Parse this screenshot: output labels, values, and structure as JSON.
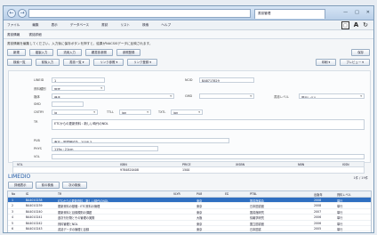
{
  "window": {
    "tab_title": "書誌管理",
    "address_text": "",
    "min_icon": "minimize-icon",
    "max_icon": "maximize-icon",
    "close_icon": "close-icon"
  },
  "menu": [
    "ファイル",
    "編集",
    "表示",
    "データベース",
    "書誌",
    "リスト",
    "検索",
    "ヘルプ"
  ],
  "subbar": [
    "書誌情報",
    "書誌詳細"
  ],
  "notice": "書誌情報を編集してください。入力後に保存ボタンを押すと、結果がNACSISデータに反映されます。",
  "toolbar1": {
    "left": [
      "新規",
      "複製入力",
      "流用入力",
      "親書誌参照",
      "参照登録"
    ],
    "right": [
      "保存"
    ]
  },
  "toolbar2": {
    "left": [
      "検索一覧",
      "前後入力",
      "書誌一覧",
      "リンク参照",
      "リンク登録"
    ],
    "right": [
      "印刷",
      "プレビュー"
    ]
  },
  "form": {
    "labels": {
      "lineid": "LINEID",
      "id": "NCID",
      "bibtype": "資料種別",
      "media": "媒体",
      "gmd": "GMD",
      "smd": "SMD",
      "level": "書誌レベル",
      "cntry": "CNTRY",
      "ttll": "TTLL",
      "txtl": "TXTL",
      "orgl": "ORGL",
      "tr": "TR",
      "pub": "PUB",
      "phys": "PHYS",
      "vol": "VOL"
    },
    "values": {
      "lineid": "1",
      "id": "BA8717829",
      "bibtype": "図書",
      "media": "冊子",
      "gmd": "",
      "smd": "",
      "level": "単行レベル",
      "cntry": "ja",
      "ttll": "jpn",
      "txtl": "jpn",
      "orgl": "",
      "tr": "ETCからの更新資料 : 新しい時代のNDL",
      "pub": "東京 : 図書館協会 , 2008.3",
      "phys": "119p ; 21cm",
      "vol": ""
    }
  },
  "grid": {
    "headers": [
      "VOL",
      "ISBN",
      "PRICE",
      "XISBN",
      "NBN",
      "ISSN"
    ],
    "row": [
      "",
      "9784820408",
      "1500",
      "",
      "",
      ""
    ]
  },
  "section": {
    "title": "LIMEDIO",
    "pager": "1件 / 19件"
  },
  "list_toolbar": [
    "詳細表示",
    "前の検索",
    "次の検索"
  ],
  "list": {
    "headers": [
      "No",
      "ID",
      "TR",
      "VLYR",
      "PUB",
      "ED",
      "PTBL",
      "出版年",
      "資料レベル"
    ],
    "rows": [
      [
        "1",
        "BA4010238",
        "ETCからの更新資料 : 新しい時代のNDL",
        "",
        "東京",
        "",
        "図書館協会",
        "2008",
        "単行"
      ],
      [
        "2",
        "BA4010239",
        "更新資料の基礎 : ETC資料の管理",
        "",
        "東京",
        "",
        "日本図書館",
        "2008",
        "単行"
      ],
      [
        "3",
        "BA4010240",
        "更新資料と目録規則の課題",
        "",
        "東京",
        "",
        "図書館研究",
        "2007",
        "単行"
      ],
      [
        "4",
        "BA4010241",
        "逐次刊行物とその管理の実際",
        "",
        "大阪",
        "",
        "情報学研究",
        "2006",
        "単行"
      ],
      [
        "5",
        "BA4010242",
        "資料管理とNDL",
        "",
        "東京",
        "",
        "国立図書館",
        "2006",
        "単行"
      ],
      [
        "6",
        "BA4010243",
        "書誌データの管理と目録",
        "",
        "東京",
        "",
        "日本図書",
        "2005",
        "単行"
      ],
      [
        "7",
        "BA4010244",
        "新しい目録規則 : 資料の管理",
        "",
        "東京",
        "",
        "日本図書館",
        "2005",
        "単行"
      ]
    ]
  },
  "colors": {
    "accent": "#2f6fc1",
    "title": "#1f5aa6"
  }
}
